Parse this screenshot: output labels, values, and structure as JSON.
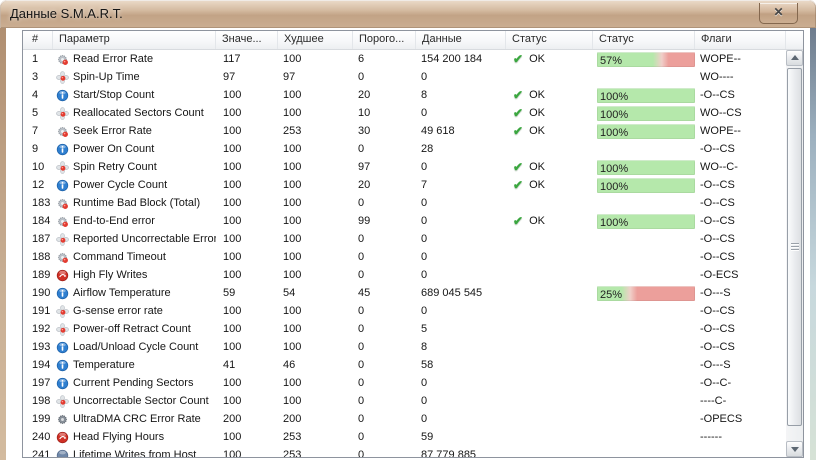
{
  "window": {
    "title": "Данные S.M.A.R.T.",
    "close_label": "✕"
  },
  "colors": {
    "titlebar_tan": "#c7ab91",
    "bar_green": "#b5e8ab",
    "bar_red": "#ec9f9b",
    "bar_red_light": "#f0cfc9",
    "ok_check_green": "#3aa73f"
  },
  "table": {
    "columns": [
      "#",
      "Параметр",
      "Значе...",
      "Худшее",
      "Порого...",
      "Данные",
      "Статус",
      "Статус",
      "Флаги"
    ],
    "rows": [
      {
        "id": "1",
        "icon": "gear-red-icon",
        "name": "Read Error Rate",
        "value": "117",
        "worst": "100",
        "threshold": "6",
        "data": "154 200 184",
        "status": "OK",
        "pct": 57,
        "pct_label": "57%",
        "flags": "WOPE--"
      },
      {
        "id": "3",
        "icon": "fan-red-icon",
        "name": "Spin-Up Time",
        "value": "97",
        "worst": "97",
        "threshold": "0",
        "data": "0",
        "status": "",
        "pct": null,
        "pct_label": "",
        "flags": "WO----"
      },
      {
        "id": "4",
        "icon": "info-icon",
        "name": "Start/Stop Count",
        "value": "100",
        "worst": "100",
        "threshold": "20",
        "data": "8",
        "status": "OK",
        "pct": 100,
        "pct_label": "100%",
        "flags": "-O--CS"
      },
      {
        "id": "5",
        "icon": "fan-red-icon",
        "name": "Reallocated Sectors Count",
        "value": "100",
        "worst": "100",
        "threshold": "10",
        "data": "0",
        "status": "OK",
        "pct": 100,
        "pct_label": "100%",
        "flags": "WO--CS"
      },
      {
        "id": "7",
        "icon": "gear-red-icon",
        "name": "Seek Error Rate",
        "value": "100",
        "worst": "253",
        "threshold": "30",
        "data": "49 618",
        "status": "OK",
        "pct": 100,
        "pct_label": "100%",
        "flags": "WOPE--"
      },
      {
        "id": "9",
        "icon": "info-icon",
        "name": "Power On Count",
        "value": "100",
        "worst": "100",
        "threshold": "0",
        "data": "28",
        "status": "",
        "pct": null,
        "pct_label": "",
        "flags": "-O--CS"
      },
      {
        "id": "10",
        "icon": "fan-red-icon",
        "name": "Spin Retry Count",
        "value": "100",
        "worst": "100",
        "threshold": "97",
        "data": "0",
        "status": "OK",
        "pct": 100,
        "pct_label": "100%",
        "flags": "WO--C-"
      },
      {
        "id": "12",
        "icon": "info-icon",
        "name": "Power Cycle Count",
        "value": "100",
        "worst": "100",
        "threshold": "20",
        "data": "7",
        "status": "OK",
        "pct": 100,
        "pct_label": "100%",
        "flags": "-O--CS"
      },
      {
        "id": "183",
        "icon": "gear-red-icon",
        "name": "Runtime Bad Block (Total)",
        "value": "100",
        "worst": "100",
        "threshold": "0",
        "data": "0",
        "status": "",
        "pct": null,
        "pct_label": "",
        "flags": "-O--CS"
      },
      {
        "id": "184",
        "icon": "gear-red-icon",
        "name": "End-to-End error",
        "value": "100",
        "worst": "100",
        "threshold": "99",
        "data": "0",
        "status": "OK",
        "pct": 100,
        "pct_label": "100%",
        "flags": "-O--CS"
      },
      {
        "id": "187",
        "icon": "fan-red-icon",
        "name": "Reported Uncorrectable Errors",
        "value": "100",
        "worst": "100",
        "threshold": "0",
        "data": "0",
        "status": "",
        "pct": null,
        "pct_label": "",
        "flags": "-O--CS"
      },
      {
        "id": "188",
        "icon": "gear-red-icon",
        "name": "Command Timeout",
        "value": "100",
        "worst": "100",
        "threshold": "0",
        "data": "0",
        "status": "",
        "pct": null,
        "pct_label": "",
        "flags": "-O--CS"
      },
      {
        "id": "189",
        "icon": "sphere-red-icon",
        "name": "High Fly Writes",
        "value": "100",
        "worst": "100",
        "threshold": "0",
        "data": "0",
        "status": "",
        "pct": null,
        "pct_label": "",
        "flags": "-O-ECS"
      },
      {
        "id": "190",
        "icon": "info-icon",
        "name": "Airflow Temperature",
        "value": "59",
        "worst": "54",
        "threshold": "45",
        "data": "689 045 545",
        "status": "",
        "pct": 25,
        "pct_label": "25%",
        "flags": "-O---S"
      },
      {
        "id": "191",
        "icon": "fan-red-icon",
        "name": "G-sense error rate",
        "value": "100",
        "worst": "100",
        "threshold": "0",
        "data": "0",
        "status": "",
        "pct": null,
        "pct_label": "",
        "flags": "-O--CS"
      },
      {
        "id": "192",
        "icon": "fan-red-icon",
        "name": "Power-off Retract Count",
        "value": "100",
        "worst": "100",
        "threshold": "0",
        "data": "5",
        "status": "",
        "pct": null,
        "pct_label": "",
        "flags": "-O--CS"
      },
      {
        "id": "193",
        "icon": "info-icon",
        "name": "Load/Unload Cycle Count",
        "value": "100",
        "worst": "100",
        "threshold": "0",
        "data": "8",
        "status": "",
        "pct": null,
        "pct_label": "",
        "flags": "-O--CS"
      },
      {
        "id": "194",
        "icon": "info-icon",
        "name": "Temperature",
        "value": "41",
        "worst": "46",
        "threshold": "0",
        "data": "58",
        "status": "",
        "pct": null,
        "pct_label": "",
        "flags": "-O---S"
      },
      {
        "id": "197",
        "icon": "info-icon",
        "name": "Current Pending Sectors",
        "value": "100",
        "worst": "100",
        "threshold": "0",
        "data": "0",
        "status": "",
        "pct": null,
        "pct_label": "",
        "flags": "-O--C-"
      },
      {
        "id": "198",
        "icon": "fan-red-icon",
        "name": "Uncorrectable Sector Count",
        "value": "100",
        "worst": "100",
        "threshold": "0",
        "data": "0",
        "status": "",
        "pct": null,
        "pct_label": "",
        "flags": "----C-"
      },
      {
        "id": "199",
        "icon": "gear-dark-icon",
        "name": "UltraDMA CRC Error Rate",
        "value": "200",
        "worst": "200",
        "threshold": "0",
        "data": "0",
        "status": "",
        "pct": null,
        "pct_label": "",
        "flags": "-OPECS"
      },
      {
        "id": "240",
        "icon": "sphere-red-icon",
        "name": "Head Flying Hours",
        "value": "100",
        "worst": "253",
        "threshold": "0",
        "data": "59",
        "status": "",
        "pct": null,
        "pct_label": "",
        "flags": "------"
      },
      {
        "id": "241",
        "icon": "sphere-blue-icon",
        "name": "Lifetime Writes from Host",
        "value": "100",
        "worst": "253",
        "threshold": "0",
        "data": "87 779 885",
        "status": "",
        "pct": null,
        "pct_label": "",
        "flags": ""
      }
    ]
  }
}
